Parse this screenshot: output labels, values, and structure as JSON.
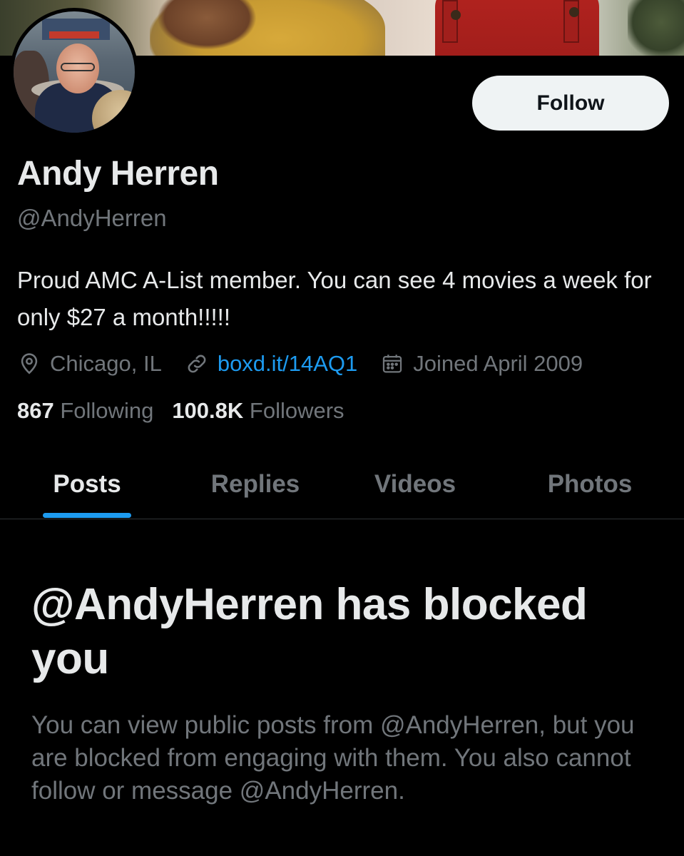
{
  "profile": {
    "name": "Andy Herren",
    "handle": "@AndyHerren",
    "bio": "Proud AMC A-List member. You can see 4 movies a week for only $27 a month!!!!!",
    "location": "Chicago, IL",
    "website": "boxd.it/14AQ1",
    "joined": "Joined April 2009"
  },
  "actions": {
    "follow_label": "Follow"
  },
  "stats": {
    "following_count": "867",
    "following_label": "Following",
    "followers_count": "100.8K",
    "followers_label": "Followers"
  },
  "tabs": [
    {
      "label": "Posts",
      "active": true
    },
    {
      "label": "Replies",
      "active": false
    },
    {
      "label": "Videos",
      "active": false
    },
    {
      "label": "Photos",
      "active": false
    }
  ],
  "blocked": {
    "title": "@AndyHerren has blocked you",
    "description": "You can view public posts from @AndyHerren, but you are blocked from engaging with them. You also cannot follow or message @AndyHerren."
  },
  "icons": {
    "location": "location-pin-icon",
    "link": "link-icon",
    "calendar": "calendar-icon"
  },
  "colors": {
    "background": "#000000",
    "accent": "#1d9bf0",
    "text_primary": "#e7e9ea",
    "text_secondary": "#71767b",
    "follow_button_bg": "#eff3f4"
  }
}
